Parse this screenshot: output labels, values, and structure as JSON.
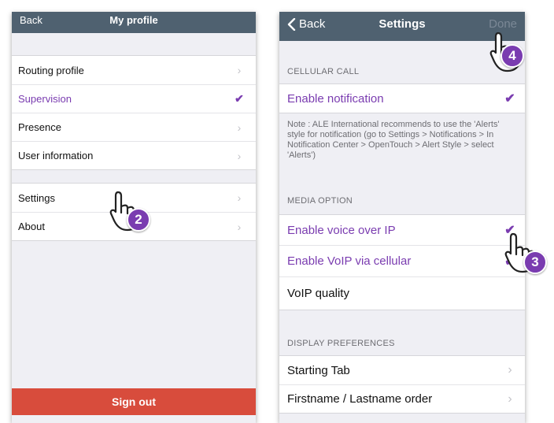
{
  "left_screen": {
    "nav": {
      "back_label": "Back",
      "title": "My profile"
    },
    "group1": [
      {
        "label": "Routing profile",
        "accessory": "chevron",
        "style": "normal"
      },
      {
        "label": "Supervision",
        "accessory": "check",
        "style": "purple"
      },
      {
        "label": "Presence",
        "accessory": "chevron",
        "style": "normal"
      },
      {
        "label": "User information",
        "accessory": "chevron",
        "style": "normal"
      }
    ],
    "group2": [
      {
        "label": "Settings",
        "accessory": "chevron",
        "style": "normal"
      },
      {
        "label": "About",
        "accessory": "chevron",
        "style": "normal"
      }
    ],
    "signout_label": "Sign out"
  },
  "right_screen": {
    "nav": {
      "back_label": "Back",
      "title": "Settings",
      "done_label": "Done"
    },
    "cellular": {
      "header": "CELLULAR CALL",
      "row": {
        "label": "Enable notification",
        "accessory": "check"
      },
      "note": "Note : ALE International recommends to use the 'Alerts' style for notification (go to Settings > Notifications > In Notification Center > OpenTouch > Alert Style > select 'Alerts')"
    },
    "media": {
      "header": "MEDIA OPTION",
      "rows": [
        {
          "label": "Enable voice over IP",
          "accessory": "check",
          "style": "purple"
        },
        {
          "label": "Enable VoIP via cellular",
          "accessory": "check",
          "style": "purple"
        },
        {
          "label": "VoIP quality",
          "accessory": "none",
          "style": "normal"
        }
      ]
    },
    "display": {
      "header": "DISPLAY PREFERENCES",
      "rows": [
        {
          "label": "Starting Tab",
          "accessory": "chevron"
        },
        {
          "label": "Firstname / Lastname order",
          "accessory": "chevron"
        }
      ]
    }
  },
  "callouts": [
    {
      "number": "2",
      "icon": "pointing-hand-icon"
    },
    {
      "number": "3",
      "icon": "pointing-hand-icon"
    },
    {
      "number": "4",
      "icon": "pointing-hand-icon"
    }
  ],
  "colors": {
    "nav_bar": "#4f6170",
    "accent_purple": "#7a3cb0",
    "signout_red": "#d84c3c",
    "grouped_background": "#efeff4"
  }
}
